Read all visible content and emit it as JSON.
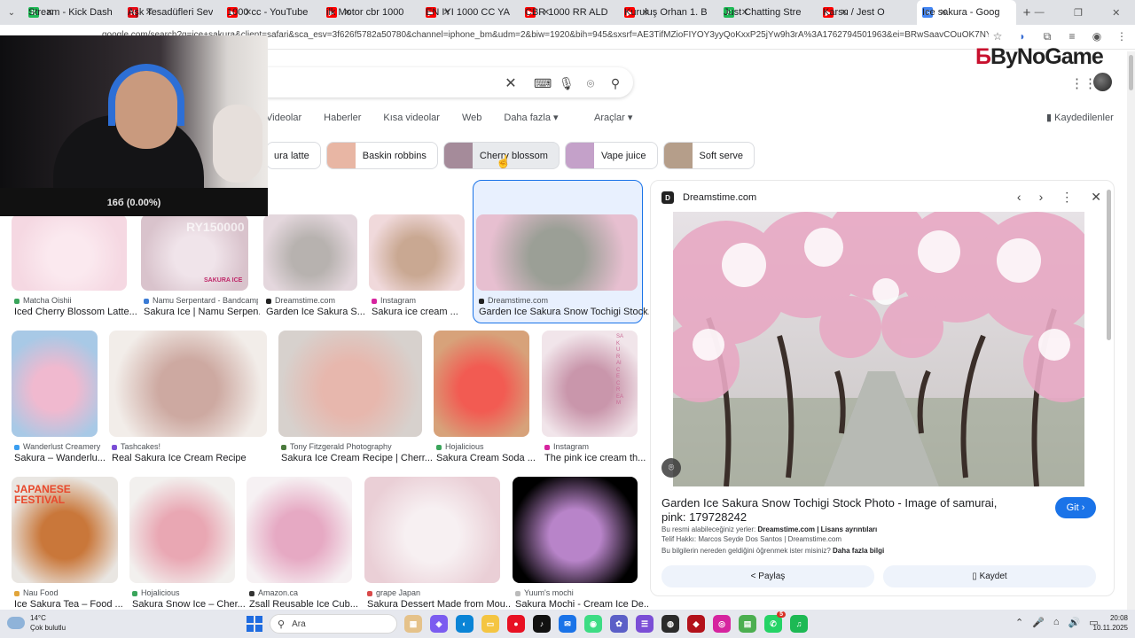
{
  "tabs": [
    {
      "title": "Stream - Kick Dash",
      "fav_color": "#1db954",
      "fav_glyph": "K",
      "active": false
    },
    {
      "title": "Aşk Tesadüfleri Sev",
      "fav_color": "#e50914",
      "fav_glyph": "N",
      "active": false
    },
    {
      "title": "1000 cc - YouTube",
      "fav_color": "#ff0000",
      "fav_glyph": "▶",
      "active": false
    },
    {
      "title": "ilk Motor cbr 1000",
      "fav_color": "#ff0000",
      "fav_glyph": "▶",
      "active": false
    },
    {
      "title": "EN IYI 1000 CC YA",
      "fav_color": "#ff0000",
      "fav_glyph": "▶",
      "active": false
    },
    {
      "title": "CBR 1000 RR ALD",
      "fav_color": "#ff0000",
      "fav_glyph": "▶",
      "active": false
    },
    {
      "title": "Kuruluş Orhan 1. B",
      "fav_color": "#ff0000",
      "fav_glyph": "▶",
      "active": false
    },
    {
      "title": "Just Chatting Stre",
      "fav_color": "#1db954",
      "fav_glyph": "K",
      "active": false
    },
    {
      "title": "Karsu / Jest O",
      "fav_color": "#ff0000",
      "fav_glyph": "▶",
      "active": false
    },
    {
      "title": "Ice sakura - Goog",
      "fav_color": "#4285f4",
      "fav_glyph": "G",
      "active": true
    }
  ],
  "address": {
    "url": "google.com/search?q=ice+sakura&client=safari&sca_esv=3f626f5782a50780&channel=iphone_bm&udm=2&biw=1920&bih=945&sxsrf=AE3TifMZioFIYOY3yyQoKxxP25jYw9h3rA%3A1762794501963&ei=BRwSaavCOuOK7NYPwa3euQM..."
  },
  "webcam": {
    "counter": "16б (0.00%)"
  },
  "logo": {
    "prefix": "Б",
    "text": "ByNoGame"
  },
  "nav": {
    "tabs": [
      "Videolar",
      "Haberler",
      "Kısa videolar",
      "Web",
      "Daha fazla ▾"
    ],
    "tools": "Araçlar ▾",
    "saved": "Kaydedilenler"
  },
  "chips": [
    {
      "label": "ura latte"
    },
    {
      "label": "Baskin robbins"
    },
    {
      "label": "Cherry blossom"
    },
    {
      "label": "Vape juice"
    },
    {
      "label": "Soft serve"
    }
  ],
  "results_row1": [
    {
      "source": "Matcha Oishii",
      "title": "Iced Cherry Blossom Latte..."
    },
    {
      "source": "Namu Serpentard - Bandcamp",
      "title": "Sakura Ice | Namu Serpen..."
    },
    {
      "source": "Dreamstime.com",
      "title": "Garden Ice Sakura S..."
    },
    {
      "source": "Instagram",
      "title": "Sakura ice cream ..."
    },
    {
      "source": "Dreamstime.com",
      "title": "Garden Ice Sakura Snow Tochigi Stock..."
    }
  ],
  "results_row2": [
    {
      "source": "Wanderlust Creamery",
      "title": "Sakura – Wanderlu..."
    },
    {
      "source": "Tashcakes!",
      "title": "Real Sakura Ice Cream Recipe"
    },
    {
      "source": "Tony Fitzgerald Photography",
      "title": "Sakura Ice Cream Recipe | Cherr..."
    },
    {
      "source": "Hojalicious",
      "title": "Sakura Cream Soda ..."
    },
    {
      "source": "Instagram",
      "title": "The pink ice cream th..."
    }
  ],
  "results_row3": [
    {
      "source": "Nau Food",
      "title": "Ice Sakura Tea – Food ..."
    },
    {
      "source": "Hojalicious",
      "title": "Sakura Snow Ice – Cher..."
    },
    {
      "source": "Amazon.ca",
      "title": "Zsall Reusable Ice Cub..."
    },
    {
      "source": "grape Japan",
      "title": "Sakura Dessert Made from Mou..."
    },
    {
      "source": "Yuum's mochi",
      "title": "Sakura Mochi - Cream Ice De..."
    }
  ],
  "image_overlay_text": {
    "festival": "JAPANESE FESTIVAL",
    "sakura_ice": "SAKURA ICE",
    "watermark": "RY150000",
    "vertical": "SAKURAICECREAM"
  },
  "panel": {
    "source": "Dreamstime.com",
    "title": "Garden Ice Sakura Snow Tochigi Stock Photo - Image of samurai, pink: 179728242",
    "visit": "Git",
    "usage_prefix": "Bu resmi alabileceğiniz yerler:",
    "usage_value": "Dreamstime.com | Lisans ayrıntıları",
    "copyright": "Telif Hakkı: Marcos Seyde Dos Santos | Dreamstime.com",
    "learn_prefix": "Bu bilgilerin nereden geldiğini öğrenmek ister misiniz?",
    "learn_link": "Daha fazla bilgi",
    "share": "Paylaş",
    "save": "Kaydet"
  },
  "taskbar": {
    "temp": "14°C",
    "weather": "Çok bulutlu",
    "search": "Ara",
    "time": "20:08",
    "date": "10.11.2025",
    "badge": "5"
  }
}
